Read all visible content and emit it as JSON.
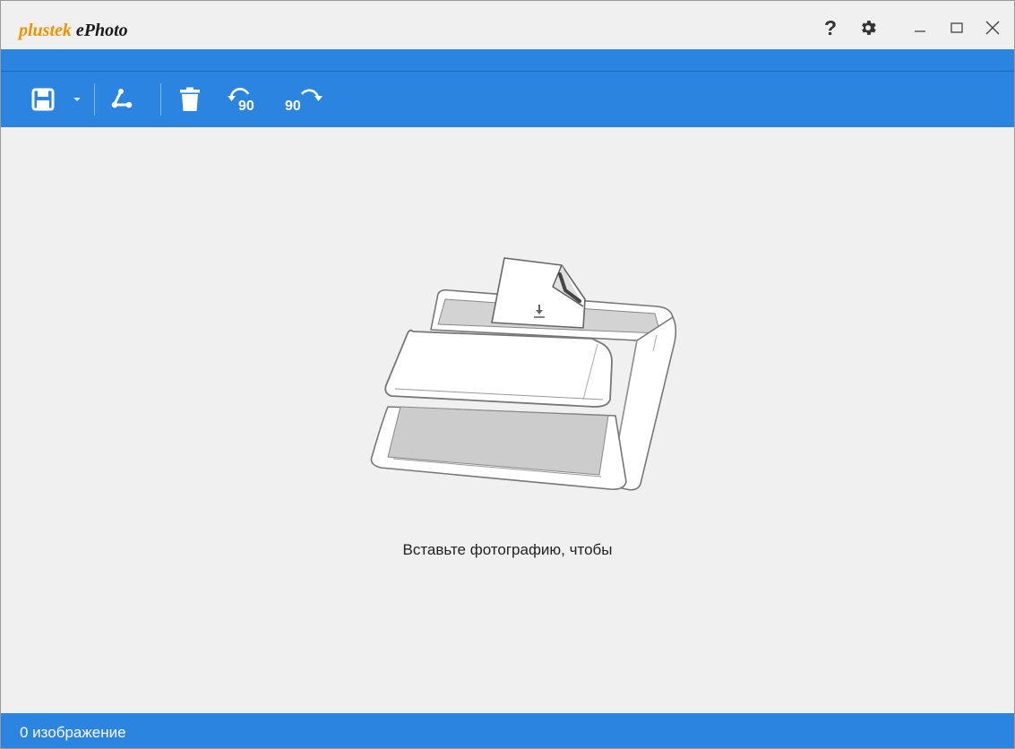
{
  "app": {
    "logo_brand_a": "plus",
    "logo_brand_b": "tek",
    "logo_app": "ePhoto",
    "help_label": "?"
  },
  "toolbar": {
    "items": [
      {
        "name": "save-icon"
      },
      {
        "name": "dropdown-arrow-icon"
      },
      {
        "name": "share-icon"
      },
      {
        "name": "trash-icon"
      },
      {
        "name": "rotate-left-90-icon",
        "label": "90"
      },
      {
        "name": "rotate-right-90-icon",
        "label": "90"
      }
    ]
  },
  "main": {
    "prompt": "Вставьте фотографию, чтобы"
  },
  "status": {
    "text": "0 изображение"
  },
  "colors": {
    "accent": "#2a84e0",
    "brand": "#f39200",
    "background": "#f0f0f0"
  }
}
